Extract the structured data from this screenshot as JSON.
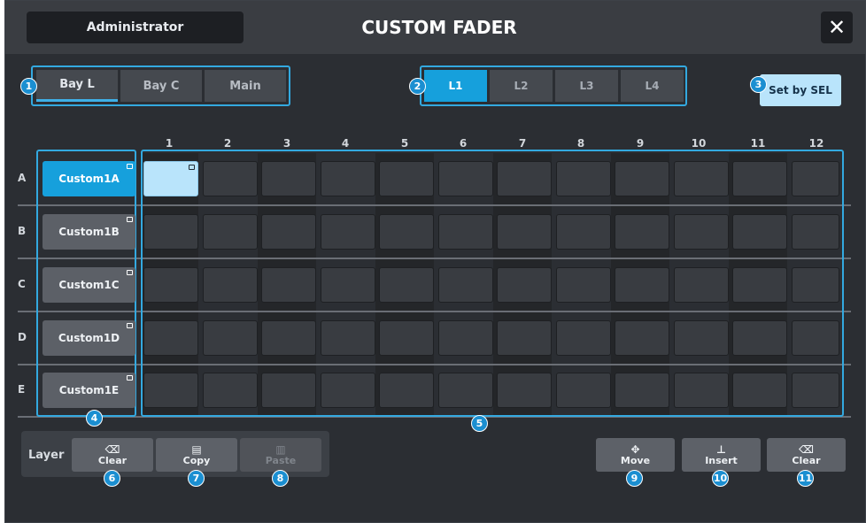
{
  "header": {
    "user": "Administrator",
    "title": "CUSTOM FADER",
    "close_glyph": "✕"
  },
  "bay_tabs": [
    "Bay L",
    "Bay C",
    "Main"
  ],
  "layer_tabs": [
    "L1",
    "L2",
    "L3",
    "L4"
  ],
  "set_by_sel_label": "Set by SEL",
  "columns": [
    "1",
    "2",
    "3",
    "4",
    "5",
    "6",
    "7",
    "8",
    "9",
    "10",
    "11",
    "12"
  ],
  "rows": [
    {
      "letter": "A",
      "label": "Custom1A"
    },
    {
      "letter": "B",
      "label": "Custom1B"
    },
    {
      "letter": "C",
      "label": "Custom1C"
    },
    {
      "letter": "D",
      "label": "Custom1D"
    },
    {
      "letter": "E",
      "label": "Custom1E"
    }
  ],
  "layer_panel": {
    "label": "Layer",
    "clear": "Clear",
    "copy": "Copy",
    "paste": "Paste"
  },
  "actions": {
    "move": "Move",
    "insert": "Insert",
    "clear": "Clear"
  },
  "icons": {
    "clear": "⌫",
    "copy": "▤",
    "paste": "▥",
    "move": "✥",
    "insert": "⊥"
  },
  "callouts": [
    "1",
    "2",
    "3",
    "4",
    "5",
    "6",
    "7",
    "8",
    "9",
    "10",
    "11"
  ],
  "colors": {
    "accent": "#16a0dc",
    "callout": "#1b8fd1",
    "selected_cell": "#b9e4fb"
  }
}
